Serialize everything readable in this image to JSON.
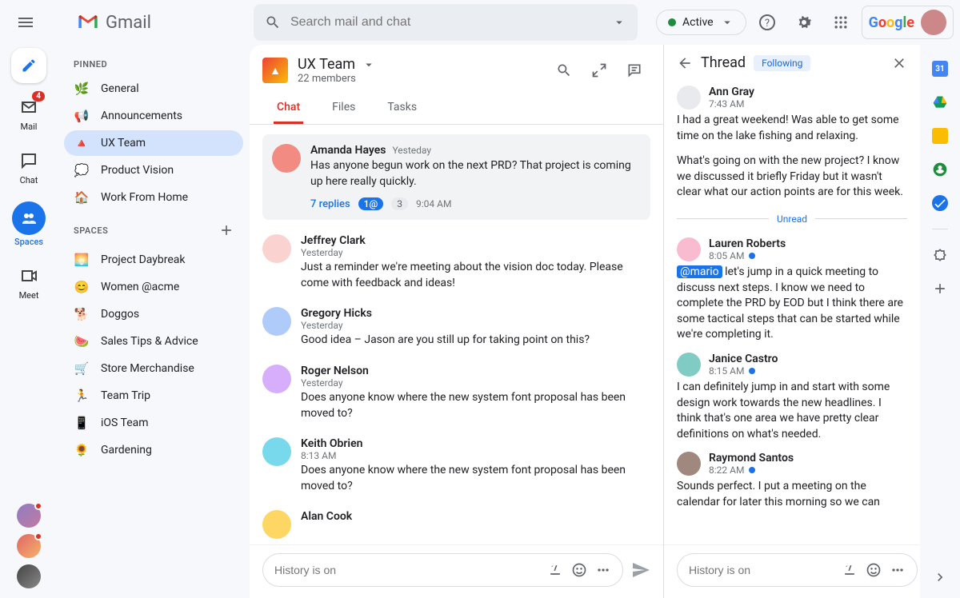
{
  "brand": "Gmail",
  "search": {
    "placeholder": "Search mail and chat"
  },
  "status": {
    "label": "Active"
  },
  "rail": {
    "mail": {
      "label": "Mail",
      "badge": "4"
    },
    "chat": {
      "label": "Chat"
    },
    "spaces": {
      "label": "Spaces"
    },
    "meet": {
      "label": "Meet"
    }
  },
  "sidebar": {
    "pinned_header": "PINNED",
    "spaces_header": "SPACES",
    "pinned": [
      {
        "emoji": "🌿",
        "label": "General"
      },
      {
        "emoji": "📢",
        "label": "Announcements"
      },
      {
        "emoji": "🔺",
        "label": "UX Team"
      },
      {
        "emoji": "💭",
        "label": "Product Vision"
      },
      {
        "emoji": "🏠",
        "label": "Work From Home"
      }
    ],
    "spaces": [
      {
        "emoji": "🌅",
        "label": "Project Daybreak"
      },
      {
        "emoji": "😊",
        "label": "Women @acme"
      },
      {
        "emoji": "🐕",
        "label": "Doggos"
      },
      {
        "emoji": "🍉",
        "label": "Sales Tips & Advice"
      },
      {
        "emoji": "🛒",
        "label": "Store Merchandise"
      },
      {
        "emoji": "🏃",
        "label": "Team Trip"
      },
      {
        "emoji": "📱",
        "label": "iOS Team"
      },
      {
        "emoji": "🌻",
        "label": "Gardening"
      }
    ]
  },
  "space": {
    "name": "UX Team",
    "members": "22 members",
    "tabs": {
      "chat": "Chat",
      "files": "Files",
      "tasks": "Tasks"
    }
  },
  "messages": [
    {
      "name": "Amanda Hayes",
      "time": "Yesteday",
      "text": "Has anyone begun work on the next PRD? That project is coming up here really quickly.",
      "replies": "7 replies",
      "mention_chip": "1@",
      "count_chip": "3",
      "reply_time": "9:04 AM"
    },
    {
      "name": "Jeffrey Clark",
      "time": "Yesterday",
      "text": "Just a reminder we're meeting about the vision doc today. Please come with feedback and ideas!"
    },
    {
      "name": "Gregory Hicks",
      "time": "Yesterday",
      "text": "Good idea – Jason are you still up for taking point on this?"
    },
    {
      "name": "Roger Nelson",
      "time": "Yesterday",
      "text": "Does anyone know where the new system font proposal has been moved to?"
    },
    {
      "name": "Keith Obrien",
      "time": "8:13 AM",
      "text": "Does anyone know where the new system font proposal has been moved to?"
    },
    {
      "name": "Alan Cook",
      "time": "",
      "text": ""
    }
  ],
  "composer": {
    "placeholder": "History is on"
  },
  "thread": {
    "title": "Thread",
    "following": "Following",
    "unread_label": "Unread",
    "messages": [
      {
        "name": "Ann Gray",
        "time": "7:43 AM",
        "text": "I had a great weekend! Was able to get some time on the lake fishing and relaxing.",
        "text2": "What's going on with the new project? I know we discussed it briefly Friday but it wasn't clear what our action points are for this week.",
        "unread": false
      },
      {
        "name": "Lauren Roberts",
        "time": "8:05 AM",
        "mention": "@mario",
        "text": " let's jump in a quick meeting to discuss next steps. I know we need to complete the PRD by EOD but I think there are some tactical steps that can be started while we're completing it.",
        "unread": true
      },
      {
        "name": "Janice Castro",
        "time": "8:15 AM",
        "text": "I can definitely jump in and start with some design work towards the new headlines. I think that's one area we have pretty clear definitions on what's needed.",
        "unread": true
      },
      {
        "name": "Raymond Santos",
        "time": "8:22 AM",
        "text": "Sounds perfect. I put a meeting on the calendar for later this morning so we can",
        "unread": true
      }
    ]
  },
  "calendar_day": "31"
}
